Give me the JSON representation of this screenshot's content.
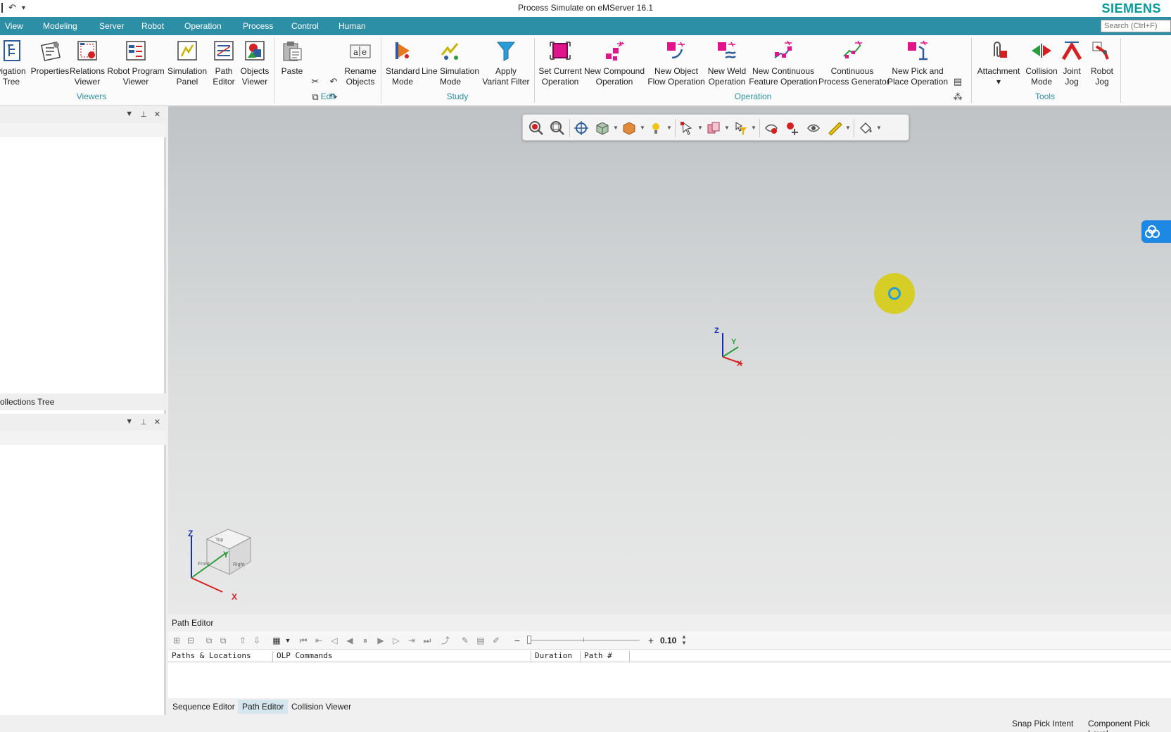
{
  "titlebar": {
    "title": "Process Simulate on eMServer 16.1",
    "brand": "SIEMENS"
  },
  "menu_tabs": [
    "View",
    "Modeling",
    "Server",
    "Robot",
    "Operation",
    "Process",
    "Control",
    "Human"
  ],
  "search": {
    "placeholder": "Search (Ctrl+F)"
  },
  "ribbon": {
    "viewers": {
      "label": "Viewers",
      "buttons": [
        {
          "line1": "vigation",
          "line2": "Tree"
        },
        {
          "line1": "Properties",
          "line2": ""
        },
        {
          "line1": "Relations",
          "line2": "Viewer"
        },
        {
          "line1": "Robot Program",
          "line2": "Viewer"
        },
        {
          "line1": "Simulation",
          "line2": "Panel"
        },
        {
          "line1": "Path",
          "line2": "Editor"
        },
        {
          "line1": "Objects",
          "line2": "Viewer"
        }
      ]
    },
    "edit": {
      "label": "Edit",
      "buttons": [
        {
          "line1": "Paste",
          "line2": ""
        },
        {
          "line1": "Rename",
          "line2": "Objects"
        }
      ]
    },
    "study": {
      "label": "Study",
      "buttons": [
        {
          "line1": "Standard",
          "line2": "Mode"
        },
        {
          "line1": "Line Simulation",
          "line2": "Mode"
        },
        {
          "line1": "Apply",
          "line2": "Variant Filter"
        }
      ]
    },
    "operation": {
      "label": "Operation",
      "buttons": [
        {
          "line1": "Set Current",
          "line2": "Operation"
        },
        {
          "line1": "New Compound",
          "line2": "Operation"
        },
        {
          "line1": "New Object",
          "line2": "Flow Operation"
        },
        {
          "line1": "New Weld",
          "line2": "Operation"
        },
        {
          "line1": "New Continuous",
          "line2": "Feature Operation"
        },
        {
          "line1": "Continuous",
          "line2": "Process Generator"
        },
        {
          "line1": "New Pick and",
          "line2": "Place Operation"
        }
      ]
    },
    "tools": {
      "label": "Tools",
      "buttons": [
        {
          "line1": "Attachment",
          "line2": "▾"
        },
        {
          "line1": "Collision",
          "line2": "Mode"
        },
        {
          "line1": "Joint",
          "line2": "Jog"
        },
        {
          "line1": "Robot",
          "line2": "Jog"
        }
      ]
    }
  },
  "left_panel": {
    "top_footer": "ollections Tree"
  },
  "viewport": {
    "axes": {
      "x": "X",
      "y": "Y",
      "z": "Z"
    },
    "cube": {
      "top": "Top",
      "front": "Front",
      "right": "Right"
    }
  },
  "path_editor": {
    "title": "Path Editor",
    "speed_value": "0.10",
    "columns": [
      "Paths & Locations",
      "OLP Commands",
      "Duration",
      "Path #"
    ],
    "bottom_tabs": [
      "Sequence Editor",
      "Path Editor",
      "Collision Viewer"
    ],
    "active_tab": "Path Editor"
  },
  "statusbar": {
    "snap": "Snap Pick Intent",
    "component": "Component Pick Level"
  },
  "colors": {
    "accent": "#2d8fa6",
    "brand": "#009999",
    "magenta": "#e0158c"
  }
}
